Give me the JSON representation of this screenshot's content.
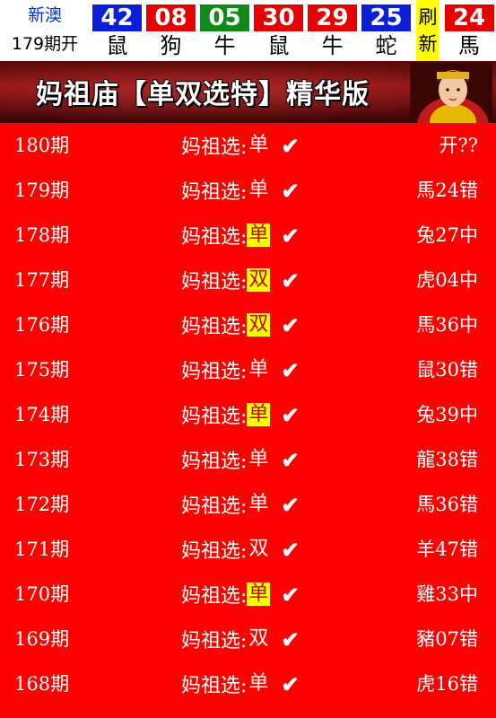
{
  "header": {
    "brand": "新澳",
    "period_label": "179期开",
    "balls": [
      {
        "number": "42",
        "zodiac": "鼠",
        "color": "#0a1fd6"
      },
      {
        "number": "08",
        "zodiac": "狗",
        "color": "#e60000"
      },
      {
        "number": "05",
        "zodiac": "牛",
        "color": "#0e8a16"
      },
      {
        "number": "30",
        "zodiac": "鼠",
        "color": "#e60000"
      },
      {
        "number": "29",
        "zodiac": "牛",
        "color": "#e60000"
      },
      {
        "number": "25",
        "zodiac": "蛇",
        "color": "#0a1fd6"
      }
    ],
    "refresh_label": "刷新",
    "special_ball": {
      "number": "24",
      "zodiac": "馬",
      "color": "#e60000"
    }
  },
  "banner": {
    "title": "妈祖庙【单双选特】精华版"
  },
  "rows": [
    {
      "issue": "180期",
      "label": "妈祖选:",
      "pick": "单",
      "hit": false,
      "check": "✔",
      "result": "开??"
    },
    {
      "issue": "179期",
      "label": "妈祖选:",
      "pick": "单",
      "hit": false,
      "check": "✔",
      "result": "馬24错"
    },
    {
      "issue": "178期",
      "label": "妈祖选:",
      "pick": "单",
      "hit": true,
      "check": "✔",
      "result": "兔27中"
    },
    {
      "issue": "177期",
      "label": "妈祖选:",
      "pick": "双",
      "hit": true,
      "check": "✔",
      "result": "虎04中"
    },
    {
      "issue": "176期",
      "label": "妈祖选:",
      "pick": "双",
      "hit": true,
      "check": "✔",
      "result": "馬36中"
    },
    {
      "issue": "175期",
      "label": "妈祖选:",
      "pick": "单",
      "hit": false,
      "check": "✔",
      "result": "鼠30错"
    },
    {
      "issue": "174期",
      "label": "妈祖选:",
      "pick": "单",
      "hit": true,
      "check": "✔",
      "result": "兔39中"
    },
    {
      "issue": "173期",
      "label": "妈祖选:",
      "pick": "单",
      "hit": false,
      "check": "✔",
      "result": "龍38错"
    },
    {
      "issue": "172期",
      "label": "妈祖选:",
      "pick": "单",
      "hit": false,
      "check": "✔",
      "result": "馬36错"
    },
    {
      "issue": "171期",
      "label": "妈祖选:",
      "pick": "双",
      "hit": false,
      "check": "✔",
      "result": "羊47错"
    },
    {
      "issue": "170期",
      "label": "妈祖选:",
      "pick": "单",
      "hit": true,
      "check": "✔",
      "result": "雞33中"
    },
    {
      "issue": "169期",
      "label": "妈祖选:",
      "pick": "双",
      "hit": false,
      "check": "✔",
      "result": "豬07错"
    },
    {
      "issue": "168期",
      "label": "妈祖选:",
      "pick": "单",
      "hit": false,
      "check": "✔",
      "result": "虎16错"
    }
  ]
}
